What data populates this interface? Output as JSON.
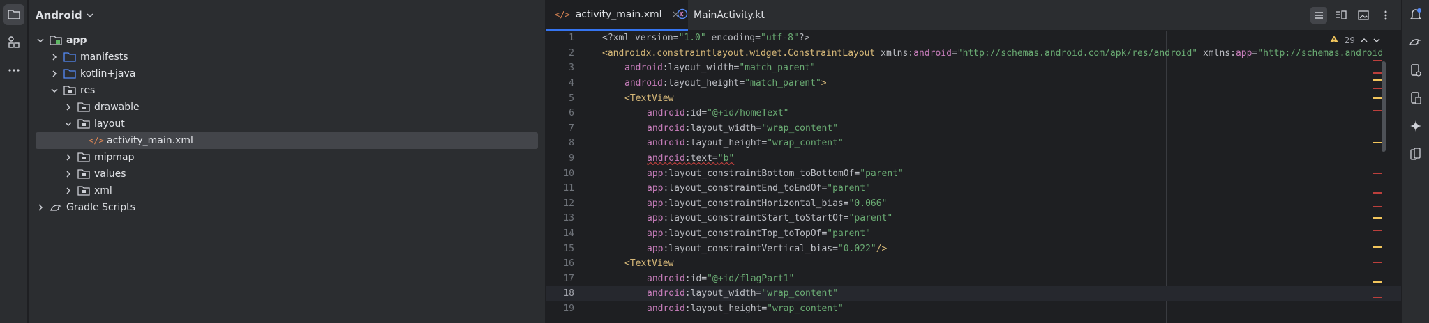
{
  "left_strip": {
    "items": [
      {
        "icon": "folder-icon",
        "active": true
      },
      {
        "icon": "structure-icon",
        "active": false
      },
      {
        "icon": "more-icon",
        "active": false
      }
    ]
  },
  "project": {
    "title": "Android",
    "tree": [
      {
        "label": "app",
        "level": 0,
        "expanded": true,
        "icon": "module-folder-icon",
        "bold": true
      },
      {
        "label": "manifests",
        "level": 1,
        "expanded": false,
        "icon": "folder-icon"
      },
      {
        "label": "kotlin+java",
        "level": 1,
        "expanded": false,
        "icon": "folder-icon"
      },
      {
        "label": "res",
        "level": 1,
        "expanded": true,
        "icon": "res-folder-icon"
      },
      {
        "label": "drawable",
        "level": 2,
        "expanded": false,
        "icon": "res-folder-icon"
      },
      {
        "label": "layout",
        "level": 2,
        "expanded": true,
        "icon": "res-folder-icon"
      },
      {
        "label": "activity_main.xml",
        "level": 3,
        "leaf": true,
        "icon": "xml-file-icon",
        "selected": true
      },
      {
        "label": "mipmap",
        "level": 2,
        "expanded": false,
        "icon": "res-folder-icon"
      },
      {
        "label": "values",
        "level": 2,
        "expanded": false,
        "icon": "res-folder-icon"
      },
      {
        "label": "xml",
        "level": 2,
        "expanded": false,
        "icon": "res-folder-icon"
      },
      {
        "label": "Gradle Scripts",
        "level": 0,
        "expanded": false,
        "icon": "gradle-icon"
      }
    ]
  },
  "tabs": [
    {
      "label": "activity_main.xml",
      "icon": "xml-file-icon",
      "active": true,
      "close": "×"
    },
    {
      "label": "MainActivity.kt",
      "icon": "kotlin-file-icon",
      "active": false
    }
  ],
  "editor": {
    "warnings_count": "29",
    "current_line": 18,
    "lines": [
      {
        "n": "1"
      },
      {
        "n": "2"
      },
      {
        "n": "3"
      },
      {
        "n": "4"
      },
      {
        "n": "5"
      },
      {
        "n": "6"
      },
      {
        "n": "7"
      },
      {
        "n": "8"
      },
      {
        "n": "9"
      },
      {
        "n": "10"
      },
      {
        "n": "11"
      },
      {
        "n": "12"
      },
      {
        "n": "13"
      },
      {
        "n": "14"
      },
      {
        "n": "15"
      },
      {
        "n": "16"
      },
      {
        "n": "17"
      },
      {
        "n": "18"
      },
      {
        "n": "19"
      }
    ],
    "code": {
      "l1": {
        "pi": "<?xml version=",
        "v1": "\"1.0\"",
        "pi2": " encoding=",
        "v2": "\"utf-8\"",
        "pi3": "?>"
      },
      "l2": {
        "tag": "<androidx.constraintlayout.widget.ConstraintLayout",
        "a1": " xmlns:",
        "ns1": "android",
        "eq1": "=",
        "v1": "\"http://schemas.android.com/apk/res/android\"",
        "a2": " xmlns:",
        "ns2": "app",
        "eq2": "=",
        "v2": "\"http://schemas.android"
      },
      "l3": {
        "ns": "android",
        "attr": ":layout_width=",
        "val": "\"match_parent\""
      },
      "l4": {
        "ns": "android",
        "attr": ":layout_height=",
        "val": "\"match_parent\"",
        "end": ">"
      },
      "l5": {
        "tag": "<TextView"
      },
      "l6": {
        "ns": "android",
        "attr": ":id=",
        "val": "\"@+id/homeText\""
      },
      "l7": {
        "ns": "android",
        "attr": ":layout_width=",
        "val": "\"wrap_content\""
      },
      "l8": {
        "ns": "android",
        "attr": ":layout_height=",
        "val": "\"wrap_content\""
      },
      "l9": {
        "ns": "android",
        "attr": ":text=",
        "val": "\"b\""
      },
      "l10": {
        "ns": "app",
        "attr": ":layout_constraintBottom_toBottomOf=",
        "val": "\"parent\""
      },
      "l11": {
        "ns": "app",
        "attr": ":layout_constraintEnd_toEndOf=",
        "val": "\"parent\""
      },
      "l12": {
        "ns": "app",
        "attr": ":layout_constraintHorizontal_bias=",
        "val": "\"0.066\""
      },
      "l13": {
        "ns": "app",
        "attr": ":layout_constraintStart_toStartOf=",
        "val": "\"parent\""
      },
      "l14": {
        "ns": "app",
        "attr": ":layout_constraintTop_toTopOf=",
        "val": "\"parent\""
      },
      "l15": {
        "ns": "app",
        "attr": ":layout_constraintVertical_bias=",
        "val": "\"0.022\"",
        "end": "/>"
      },
      "l16": {
        "tag": "<TextView"
      },
      "l17": {
        "ns": "android",
        "attr": ":id=",
        "val": "\"@+id/flagPart1\""
      },
      "l18": {
        "ns": "android",
        "attr": ":layout_width=",
        "val": "\"wrap_content\""
      },
      "l19": {
        "ns": "android",
        "attr": ":layout_height=",
        "val": "\"wrap_content\""
      }
    }
  },
  "right_strip": {
    "items": [
      "notifications-icon",
      "gemini-icon",
      "device-manager-icon",
      "running-devices-icon",
      "ai-sparkle-icon",
      "device-mirror-icon"
    ]
  },
  "colors": {
    "accent": "#3574f0",
    "tag": "#d5b778",
    "namespace": "#c77dbb",
    "string": "#6aab73",
    "warning": "#f2c55c",
    "error_mark": "#bc3f3c"
  }
}
